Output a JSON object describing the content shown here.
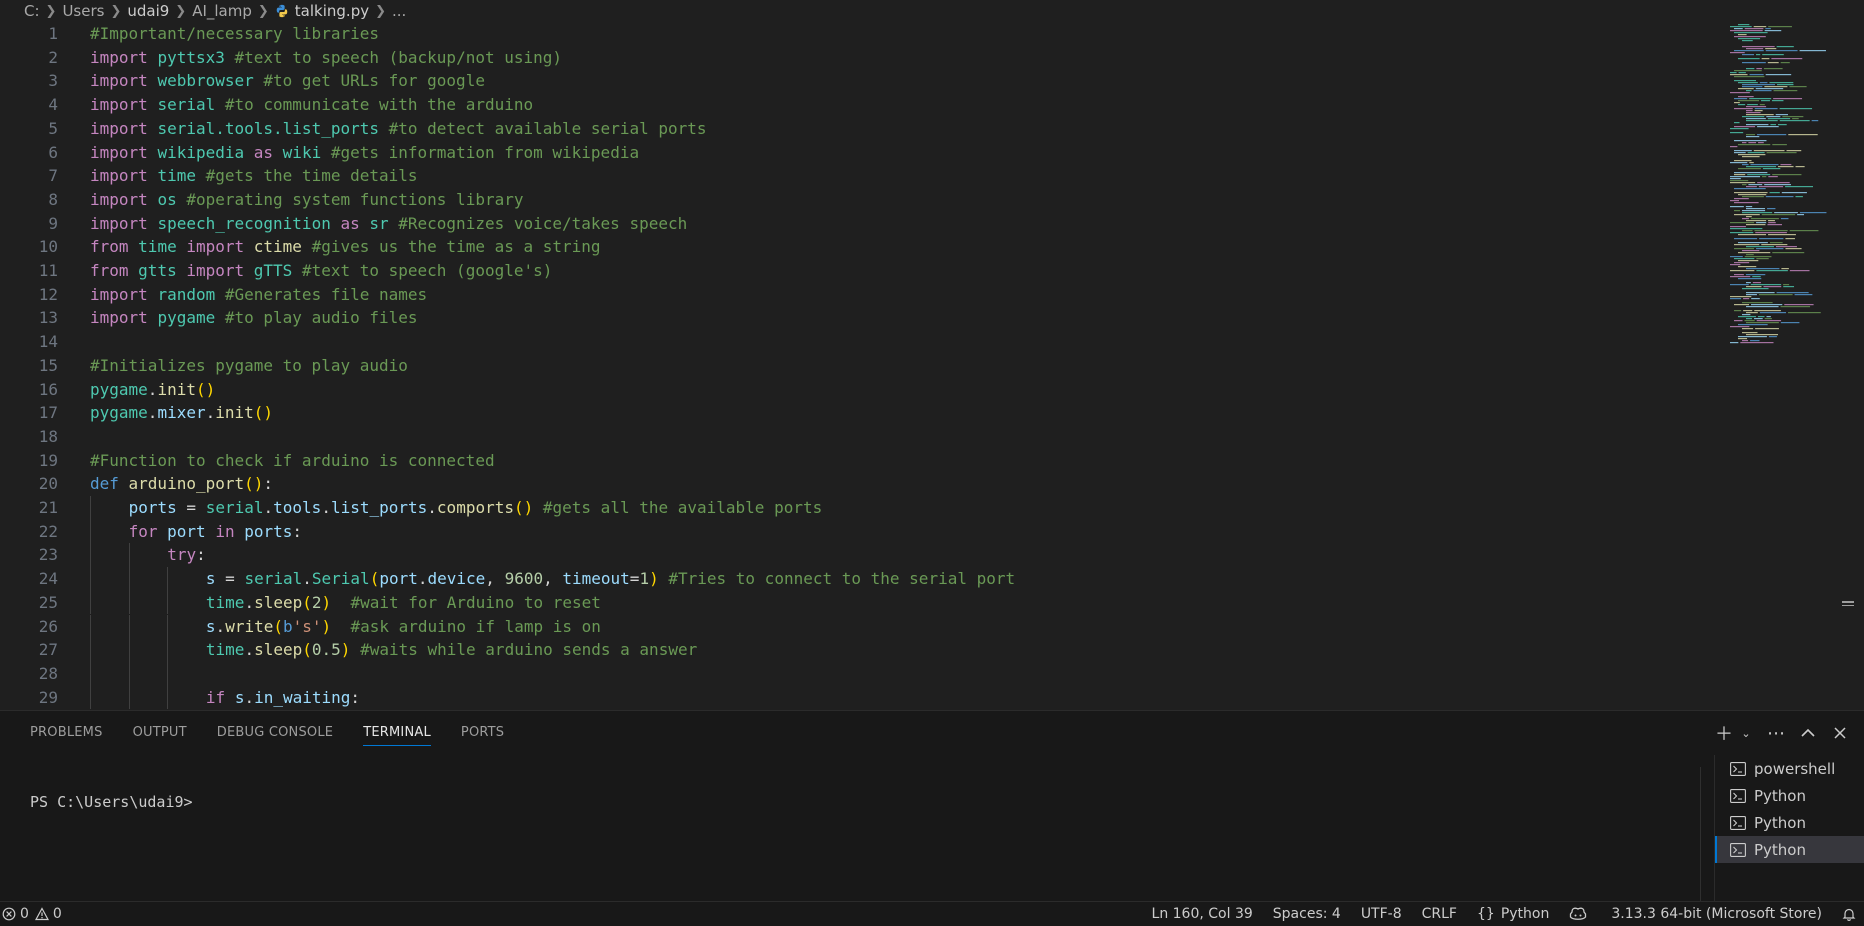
{
  "breadcrumb": {
    "items": [
      "C:",
      "Users",
      "udai9",
      "AI_lamp",
      "talking.py",
      "..."
    ]
  },
  "editor": {
    "lines": [
      {
        "n": "1",
        "indent": 0,
        "tokens": [
          [
            "cmt",
            "#Important/necessary libraries"
          ]
        ]
      },
      {
        "n": "2",
        "indent": 0,
        "tokens": [
          [
            "kw",
            "import "
          ],
          [
            "mod",
            "pyttsx3"
          ],
          [
            "cmt",
            " #text to speech (backup/not using)"
          ]
        ]
      },
      {
        "n": "3",
        "indent": 0,
        "tokens": [
          [
            "kw",
            "import "
          ],
          [
            "mod",
            "webbrowser"
          ],
          [
            "cmt",
            " #to get URLs for google"
          ]
        ]
      },
      {
        "n": "4",
        "indent": 0,
        "tokens": [
          [
            "kw",
            "import "
          ],
          [
            "mod",
            "serial"
          ],
          [
            "cmt",
            " #to communicate with the arduino"
          ]
        ]
      },
      {
        "n": "5",
        "indent": 0,
        "tokens": [
          [
            "kw",
            "import "
          ],
          [
            "mod",
            "serial.tools.list_ports"
          ],
          [
            "cmt",
            " #to detect available serial ports"
          ]
        ]
      },
      {
        "n": "6",
        "indent": 0,
        "tokens": [
          [
            "kw",
            "import "
          ],
          [
            "mod",
            "wikipedia"
          ],
          [
            "kw",
            " as "
          ],
          [
            "mod",
            "wiki"
          ],
          [
            "cmt",
            " #gets information from wikipedia"
          ]
        ]
      },
      {
        "n": "7",
        "indent": 0,
        "tokens": [
          [
            "kw",
            "import "
          ],
          [
            "mod",
            "time"
          ],
          [
            "cmt",
            " #gets the time details"
          ]
        ]
      },
      {
        "n": "8",
        "indent": 0,
        "tokens": [
          [
            "kw",
            "import "
          ],
          [
            "mod",
            "os"
          ],
          [
            "cmt",
            " #operating system functions library"
          ]
        ]
      },
      {
        "n": "9",
        "indent": 0,
        "tokens": [
          [
            "kw",
            "import "
          ],
          [
            "mod",
            "speech_recognition"
          ],
          [
            "kw",
            " as "
          ],
          [
            "mod",
            "sr"
          ],
          [
            "cmt",
            " #Recognizes voice/takes speech"
          ]
        ]
      },
      {
        "n": "10",
        "indent": 0,
        "tokens": [
          [
            "kw",
            "from "
          ],
          [
            "mod",
            "time"
          ],
          [
            "kw",
            " import "
          ],
          [
            "fn",
            "ctime"
          ],
          [
            "cmt",
            " #gives us the time as a string"
          ]
        ]
      },
      {
        "n": "11",
        "indent": 0,
        "tokens": [
          [
            "kw",
            "from "
          ],
          [
            "mod",
            "gtts"
          ],
          [
            "kw",
            " import "
          ],
          [
            "mod",
            "gTTS"
          ],
          [
            "cmt",
            " #text to speech (google's)"
          ]
        ]
      },
      {
        "n": "12",
        "indent": 0,
        "tokens": [
          [
            "kw",
            "import "
          ],
          [
            "mod",
            "random"
          ],
          [
            "cmt",
            " #Generates file names"
          ]
        ]
      },
      {
        "n": "13",
        "indent": 0,
        "tokens": [
          [
            "kw",
            "import "
          ],
          [
            "mod",
            "pygame"
          ],
          [
            "cmt",
            " #to play audio files"
          ]
        ]
      },
      {
        "n": "14",
        "indent": 0,
        "tokens": []
      },
      {
        "n": "15",
        "indent": 0,
        "tokens": [
          [
            "cmt",
            "#Initializes pygame to play audio"
          ]
        ]
      },
      {
        "n": "16",
        "indent": 0,
        "tokens": [
          [
            "mod",
            "pygame"
          ],
          [
            "pl",
            "."
          ],
          [
            "fn",
            "init"
          ],
          [
            "p1",
            "()"
          ]
        ]
      },
      {
        "n": "17",
        "indent": 0,
        "tokens": [
          [
            "mod",
            "pygame"
          ],
          [
            "pl",
            "."
          ],
          [
            "var",
            "mixer"
          ],
          [
            "pl",
            "."
          ],
          [
            "fn",
            "init"
          ],
          [
            "p1",
            "()"
          ]
        ]
      },
      {
        "n": "18",
        "indent": 0,
        "tokens": []
      },
      {
        "n": "19",
        "indent": 0,
        "tokens": [
          [
            "cmt",
            "#Function to check if arduino is connected"
          ]
        ]
      },
      {
        "n": "20",
        "indent": 0,
        "tokens": [
          [
            "def",
            "def "
          ],
          [
            "fn",
            "arduino_port"
          ],
          [
            "p1",
            "()"
          ],
          [
            "pl",
            ":"
          ]
        ]
      },
      {
        "n": "21",
        "indent": 1,
        "tokens": [
          [
            "var",
            "ports"
          ],
          [
            "pl",
            " = "
          ],
          [
            "mod",
            "serial"
          ],
          [
            "pl",
            "."
          ],
          [
            "var",
            "tools"
          ],
          [
            "pl",
            "."
          ],
          [
            "var",
            "list_ports"
          ],
          [
            "pl",
            "."
          ],
          [
            "fn",
            "comports"
          ],
          [
            "p1",
            "()"
          ],
          [
            "cmt",
            " #gets all the available ports"
          ]
        ]
      },
      {
        "n": "22",
        "indent": 1,
        "tokens": [
          [
            "kw",
            "for "
          ],
          [
            "var",
            "port"
          ],
          [
            "kw",
            " in "
          ],
          [
            "var",
            "ports"
          ],
          [
            "pl",
            ":"
          ]
        ]
      },
      {
        "n": "23",
        "indent": 2,
        "tokens": [
          [
            "kw",
            "try"
          ],
          [
            "pl",
            ":"
          ]
        ]
      },
      {
        "n": "24",
        "indent": 3,
        "tokens": [
          [
            "var",
            "s"
          ],
          [
            "pl",
            " = "
          ],
          [
            "mod",
            "serial"
          ],
          [
            "pl",
            "."
          ],
          [
            "mod",
            "Serial"
          ],
          [
            "p1",
            "("
          ],
          [
            "var",
            "port"
          ],
          [
            "pl",
            "."
          ],
          [
            "var",
            "device"
          ],
          [
            "pl",
            ", "
          ],
          [
            "num",
            "9600"
          ],
          [
            "pl",
            ", "
          ],
          [
            "var",
            "timeout"
          ],
          [
            "pl",
            "="
          ],
          [
            "num",
            "1"
          ],
          [
            "p1",
            ")"
          ],
          [
            "cmt",
            " #Tries to connect to the serial port"
          ]
        ]
      },
      {
        "n": "25",
        "indent": 3,
        "tokens": [
          [
            "mod",
            "time"
          ],
          [
            "pl",
            "."
          ],
          [
            "fn",
            "sleep"
          ],
          [
            "p1",
            "("
          ],
          [
            "num",
            "2"
          ],
          [
            "p1",
            ")"
          ],
          [
            "cmt",
            "  #wait for Arduino to reset"
          ]
        ]
      },
      {
        "n": "26",
        "indent": 3,
        "tokens": [
          [
            "var",
            "s"
          ],
          [
            "pl",
            "."
          ],
          [
            "fn",
            "write"
          ],
          [
            "p1",
            "("
          ],
          [
            "def",
            "b"
          ],
          [
            "str",
            "'s'"
          ],
          [
            "p1",
            ")"
          ],
          [
            "cmt",
            "  #ask arduino if lamp is on"
          ]
        ]
      },
      {
        "n": "27",
        "indent": 3,
        "tokens": [
          [
            "mod",
            "time"
          ],
          [
            "pl",
            "."
          ],
          [
            "fn",
            "sleep"
          ],
          [
            "p1",
            "("
          ],
          [
            "num",
            "0.5"
          ],
          [
            "p1",
            ")"
          ],
          [
            "cmt",
            " #waits while arduino sends a answer"
          ]
        ]
      },
      {
        "n": "28",
        "indent": 3,
        "tokens": []
      },
      {
        "n": "29",
        "indent": 3,
        "tokens": [
          [
            "kw",
            "if "
          ],
          [
            "var",
            "s"
          ],
          [
            "pl",
            "."
          ],
          [
            "var",
            "in_waiting"
          ],
          [
            "pl",
            ":"
          ]
        ]
      }
    ]
  },
  "panel": {
    "tabs": [
      {
        "label": "PROBLEMS",
        "active": false
      },
      {
        "label": "OUTPUT",
        "active": false
      },
      {
        "label": "DEBUG CONSOLE",
        "active": false
      },
      {
        "label": "TERMINAL",
        "active": true
      },
      {
        "label": "PORTS",
        "active": false
      }
    ],
    "terminal_output": "PS C:\\Users\\udai9>",
    "terminals": [
      {
        "label": "powershell",
        "active": false
      },
      {
        "label": "Python",
        "active": false
      },
      {
        "label": "Python",
        "active": false
      },
      {
        "label": "Python",
        "active": true
      }
    ]
  },
  "statusbar": {
    "errors": "0",
    "warnings": "0",
    "position": "Ln 160, Col 39",
    "spaces": "Spaces: 4",
    "encoding": "UTF-8",
    "eol": "CRLF",
    "language": "Python",
    "interpreter": "3.13.3 64-bit (Microsoft Store)"
  },
  "colors": {
    "background": "#1f1f1f",
    "accent": "#0078d4",
    "keyword": "#c586c0",
    "module": "#4ec9b0",
    "comment": "#6a9955"
  },
  "icons": {
    "python_file": "python-icon",
    "terminal": "terminal-icon",
    "error": "error-icon",
    "warning": "warning-icon",
    "copilot": "copilot-icon",
    "bell": "bell-icon"
  }
}
